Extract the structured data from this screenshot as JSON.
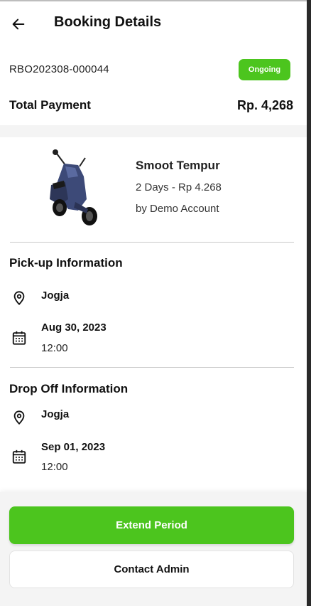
{
  "header": {
    "back_icon": "arrow-left-icon",
    "title": "Booking Details"
  },
  "booking": {
    "id": "RBO202308-000044",
    "status": "Ongoing",
    "total_label": "Total Payment",
    "total_value": "Rp. 4,268"
  },
  "product": {
    "image": "scooter-image",
    "name": "Smoot Tempur",
    "duration": "2 Days - Rp 4.268",
    "owner": "by Demo Account"
  },
  "pickup": {
    "title": "Pick-up Information",
    "location_icon": "location-pin-icon",
    "location": "Jogja",
    "calendar_icon": "calendar-icon",
    "date": "Aug 30, 2023",
    "time": "12:00"
  },
  "dropoff": {
    "title": "Drop Off Information",
    "location_icon": "location-pin-icon",
    "location": "Jogja",
    "calendar_icon": "calendar-icon",
    "date": "Sep 01, 2023",
    "time": "12:00"
  },
  "actions": {
    "extend_label": "Extend Period",
    "contact_label": "Contact Admin"
  },
  "colors": {
    "accent": "#4cc51e",
    "background_band": "#f4f4f4"
  }
}
